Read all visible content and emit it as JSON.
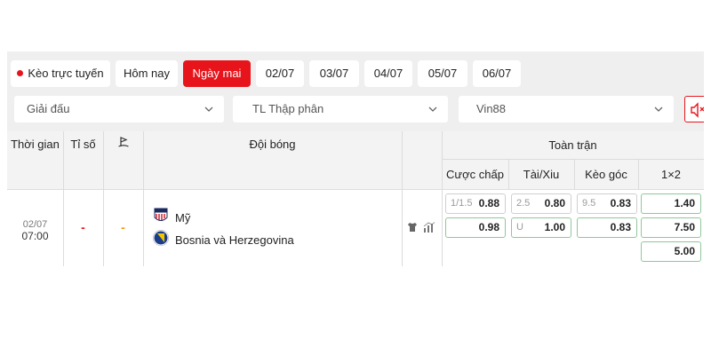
{
  "tabs": [
    {
      "label": "Kèo trực tuyến",
      "live": true
    },
    {
      "label": "Hôm nay"
    },
    {
      "label": "Ngày mai",
      "active": true
    },
    {
      "label": "02/07"
    },
    {
      "label": "03/07"
    },
    {
      "label": "04/07"
    },
    {
      "label": "05/07"
    },
    {
      "label": "06/07"
    }
  ],
  "filters": {
    "league": "Giải đấu",
    "odds_format": "TL Thập phân",
    "bookmaker": "Vin88",
    "sound_icon": "sound-icon"
  },
  "table": {
    "headers": {
      "time": "Thời gian",
      "score": "Tỉ số",
      "teams": "Đội bóng",
      "full_match": "Toàn trận",
      "handicap": "Cược chấp",
      "over_under": "Tài/Xiu",
      "corners": "Kèo góc",
      "one_x_two": "1×2"
    },
    "match": {
      "date": "02/07",
      "time": "07:00",
      "score": "-",
      "extra": "-",
      "home": "Mỹ",
      "away": "Bosnia và Herzegovina",
      "handicap": [
        {
          "line": "1/1.5",
          "value": "0.88"
        },
        {
          "line": "",
          "value": "0.98"
        }
      ],
      "over_under": [
        {
          "line": "2.5",
          "value": "0.80"
        },
        {
          "line": "U",
          "value": "1.00"
        }
      ],
      "corners": [
        {
          "line": "9.5",
          "value": "0.83"
        },
        {
          "line": "",
          "value": "0.83"
        }
      ],
      "one_x_two": [
        "1.40",
        "7.50",
        "5.00"
      ]
    }
  },
  "colors": {
    "accent": "#e8141b",
    "odds_border": "#8fc79a",
    "panel_bg": "#efefef"
  }
}
